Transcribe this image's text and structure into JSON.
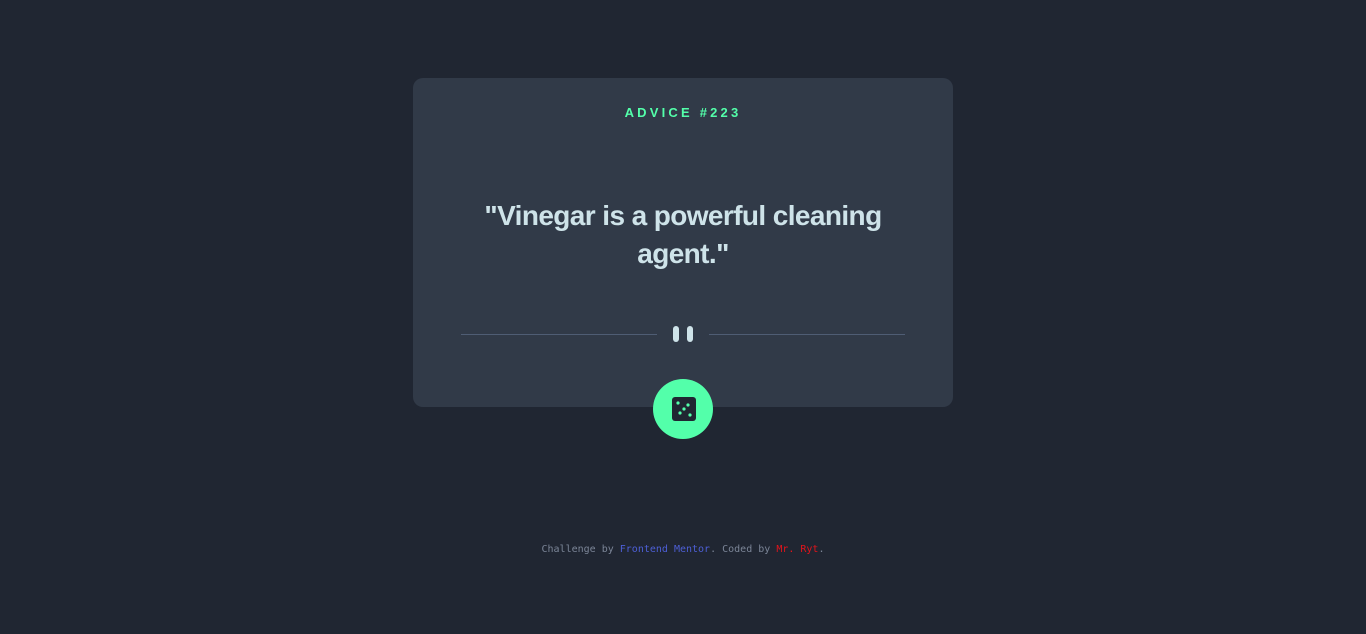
{
  "card": {
    "label_prefix": "ADVICE #",
    "advice_number": "223",
    "quote": "\"Vinegar is a powerful cleaning agent.\""
  },
  "icons": {
    "divider": "pause-icon",
    "button": "dice-icon"
  },
  "footer": {
    "prefix": "Challenge by ",
    "link1": "Frontend Mentor",
    "middle": ". Coded by ",
    "link2": "Mr. Ryt",
    "suffix": "."
  },
  "colors": {
    "background": "#202632",
    "card": "#313a48",
    "accent": "#53ffaa",
    "quote_text": "#cee3e9",
    "link1": "#4d5fd6",
    "link2": "#e3141b"
  }
}
